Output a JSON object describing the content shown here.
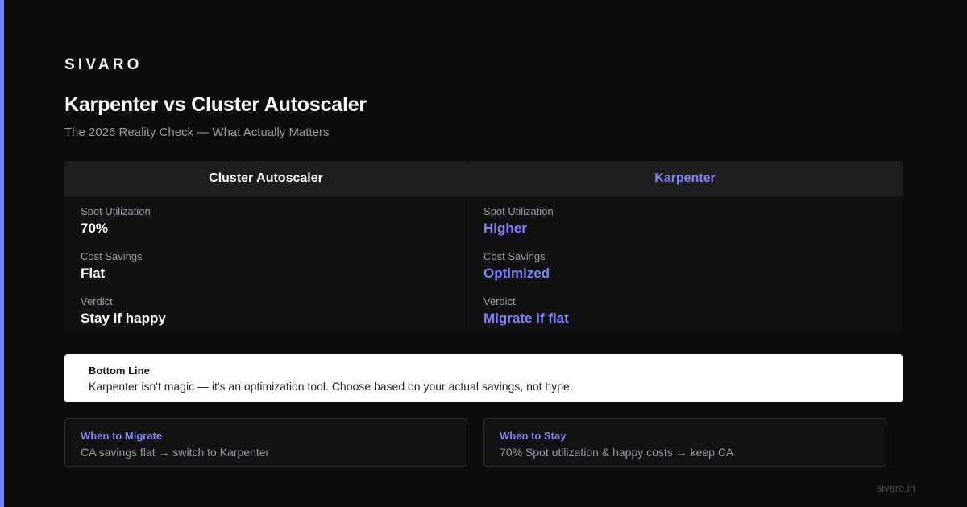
{
  "brand": "SIVARO",
  "title": "Karpenter vs Cluster Autoscaler",
  "subtitle": "The 2026 Reality Check — What Actually Matters",
  "colors": {
    "background": "#0c0c0d",
    "accent": "#7b80f0",
    "header_bg": "#1e1e21"
  },
  "comparison": {
    "left": {
      "header": "Cluster Autoscaler",
      "rows": [
        {
          "label": "Spot Utilization",
          "value": "70%"
        },
        {
          "label": "Cost Savings",
          "value": "Flat"
        },
        {
          "label": "Verdict",
          "value": "Stay if happy"
        }
      ]
    },
    "right": {
      "header": "Karpenter",
      "rows": [
        {
          "label": "Spot Utilization",
          "value": "Higher"
        },
        {
          "label": "Cost Savings",
          "value": "Optimized"
        },
        {
          "label": "Verdict",
          "value": "Migrate if flat"
        }
      ]
    }
  },
  "bottom_line": {
    "title": "Bottom Line",
    "text": "Karpenter isn't magic — it's an optimization tool. Choose based on your actual savings, not hype."
  },
  "cards": [
    {
      "title": "When to Migrate",
      "text": "CA savings flat → switch to Karpenter"
    },
    {
      "title": "When to Stay",
      "text": "70% Spot utilization & happy costs → keep CA"
    }
  ],
  "footer_url": "sivaro.in"
}
